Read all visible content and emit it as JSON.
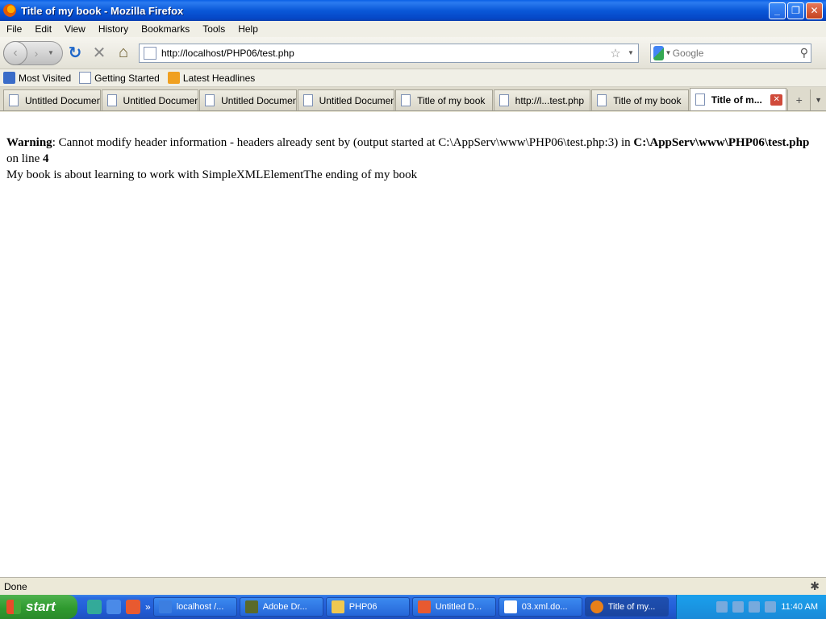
{
  "window": {
    "title": "Title of my book - Mozilla Firefox"
  },
  "menu": [
    "File",
    "Edit",
    "View",
    "History",
    "Bookmarks",
    "Tools",
    "Help"
  ],
  "nav": {
    "url": "http://localhost/PHP06/test.php",
    "search_placeholder": "Google"
  },
  "bookmarks": [
    "Most Visited",
    "Getting Started",
    "Latest Headlines"
  ],
  "tabs": [
    "Untitled Document",
    "Untitled Document",
    "Untitled Document",
    "Untitled Document",
    "Title of my book",
    "http://l...test.php",
    "Title of my book",
    "Title of m..."
  ],
  "content": {
    "warning_label": "Warning",
    "warning_text": ": Cannot modify header information - headers already sent by (output started at C:\\AppServ\\www\\PHP06\\test.php:3) in ",
    "warning_file": "C:\\AppServ\\www\\PHP06\\test.php",
    "on_line": " on line ",
    "line_number": "4",
    "body_text": "My book is about learning to work with SimpleXMLElementThe ending of my book"
  },
  "status": "Done",
  "taskbar": {
    "start": "start",
    "tasks": [
      "localhost /...",
      "Adobe Dr...",
      "PHP06",
      "Untitled D...",
      "03.xml.do...",
      "Title of my..."
    ],
    "clock": "11:40 AM"
  }
}
